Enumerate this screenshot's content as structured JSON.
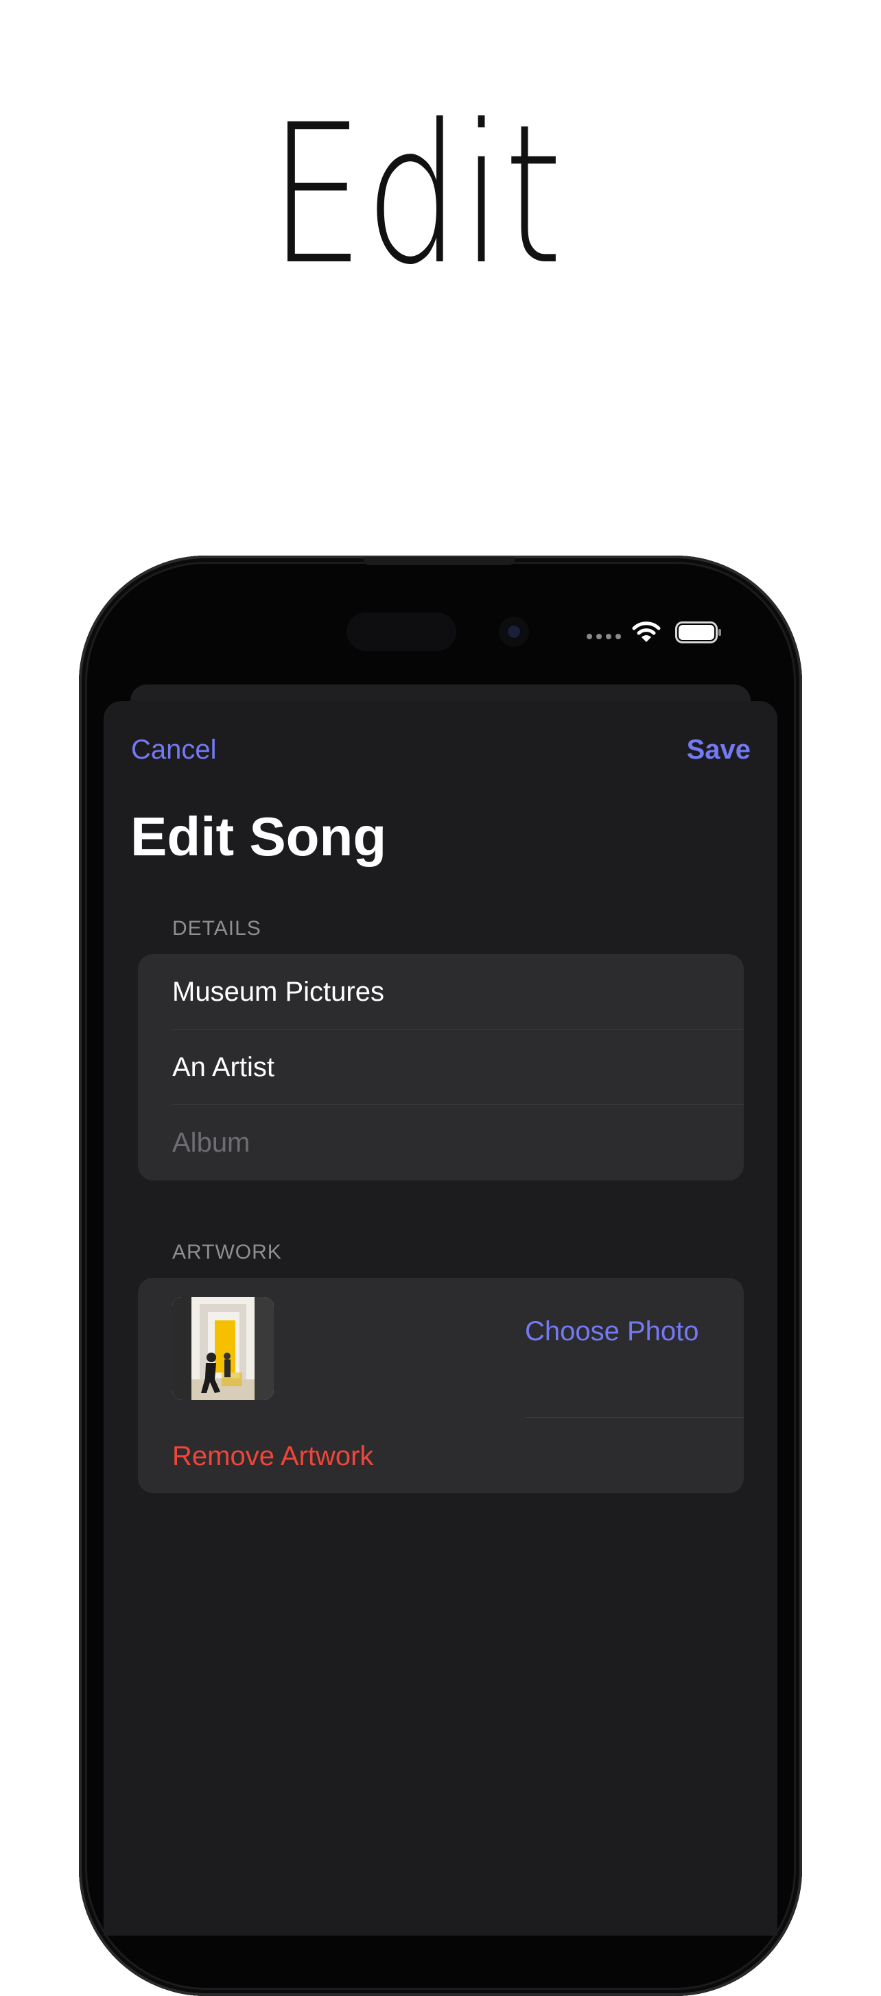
{
  "hero": {
    "title": "Edit"
  },
  "navigation": {
    "cancel_label": "Cancel",
    "save_label": "Save"
  },
  "page_title": "Edit Song",
  "details": {
    "header": "DETAILS",
    "title_value": "Museum Pictures",
    "artist_value": "An Artist",
    "album_placeholder": "Album"
  },
  "artwork": {
    "header": "ARTWORK",
    "choose_photo_label": "Choose Photo",
    "remove_label": "Remove Artwork"
  },
  "colors": {
    "accent": "#7479f4",
    "destructive": "#f0453a",
    "sheet_background": "#1c1c1e",
    "group_background": "#2c2c2e"
  },
  "icons": [
    "wifi-icon",
    "battery-icon",
    "signal-dots-icon"
  ]
}
